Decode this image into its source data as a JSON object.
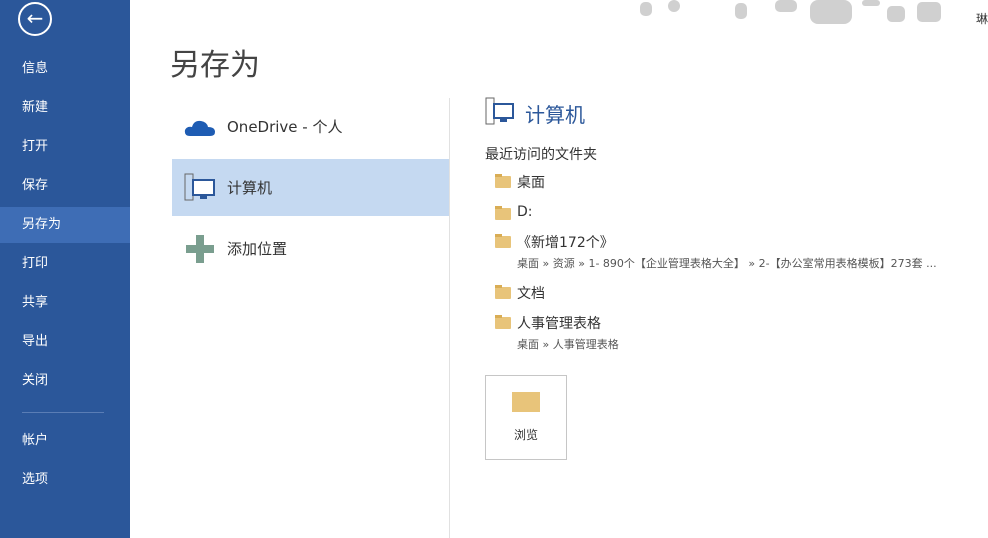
{
  "sidebar": {
    "items": [
      {
        "label": "信息"
      },
      {
        "label": "新建"
      },
      {
        "label": "打开"
      },
      {
        "label": "保存"
      },
      {
        "label": "另存为"
      },
      {
        "label": "打印"
      },
      {
        "label": "共享"
      },
      {
        "label": "导出"
      },
      {
        "label": "关闭"
      },
      {
        "label": "帐户"
      },
      {
        "label": "选项"
      }
    ]
  },
  "title": "另存为",
  "places": [
    {
      "label": "OneDrive - 个人"
    },
    {
      "label": "计算机"
    },
    {
      "label": "添加位置"
    }
  ],
  "right": {
    "title": "计算机",
    "recent_label": "最近访问的文件夹",
    "folders": [
      {
        "name": "桌面",
        "path": ""
      },
      {
        "name": "D:",
        "path": ""
      },
      {
        "name": "《新增172个》",
        "path": "桌面 » 资源 » 1- 890个【企业管理表格大全】 » 2-【办公室常用表格模板】273套 ..."
      },
      {
        "name": "文档",
        "path": ""
      },
      {
        "name": "人事管理表格",
        "path": "桌面 » 人事管理表格"
      }
    ],
    "browse": "浏览"
  },
  "user": "琳",
  "colors": {
    "accent": "#2b579a",
    "selected": "#c5d9f1"
  }
}
